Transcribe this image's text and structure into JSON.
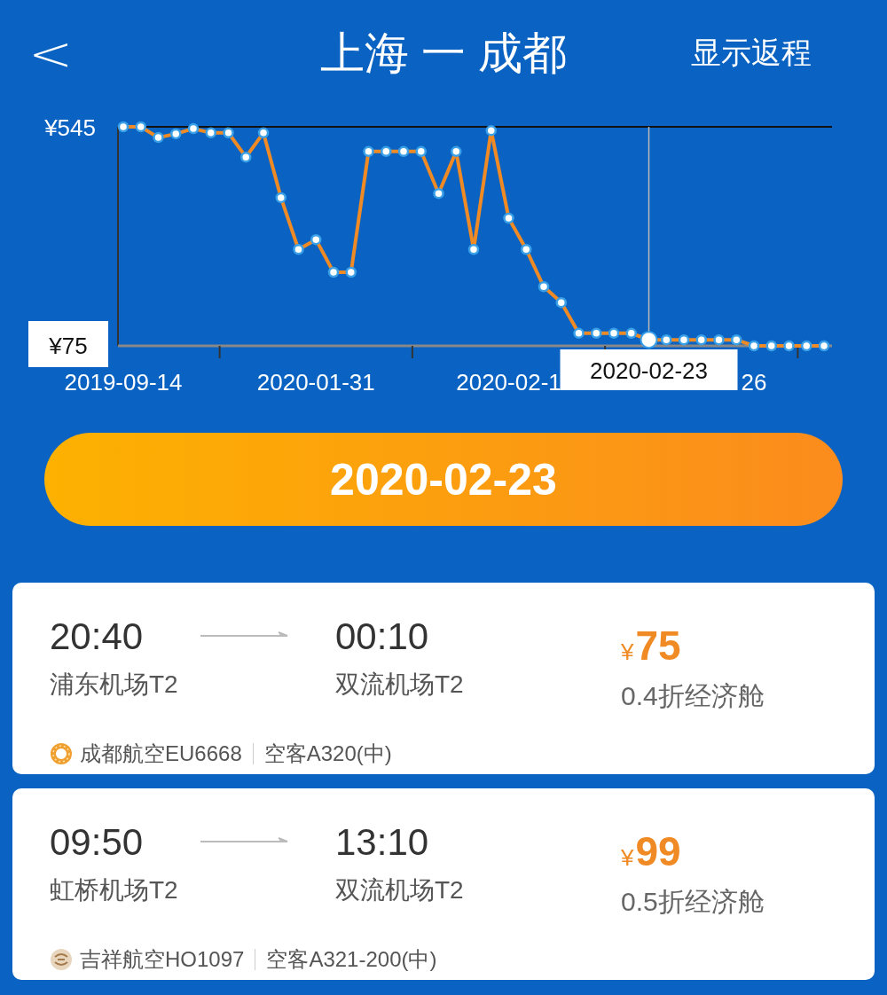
{
  "header": {
    "back": "<",
    "title": "上海 一 成都",
    "return_toggle": "显示返程"
  },
  "chart": {
    "chart_data": {
      "type": "line",
      "categories": [
        "2019-09-14",
        null,
        null,
        null,
        null,
        null,
        null,
        null,
        null,
        null,
        null,
        "2020-01-31",
        null,
        null,
        null,
        null,
        null,
        null,
        null,
        null,
        null,
        null,
        "2020-02-1",
        null,
        null,
        null,
        null,
        null,
        null,
        null,
        null,
        null,
        null,
        null,
        null,
        null,
        "26",
        null,
        null,
        null,
        null
      ],
      "series": [
        {
          "color": "#f08a24",
          "marker": "circle",
          "values": [
            545,
            545,
            522,
            530,
            541,
            532,
            532,
            480,
            532,
            393,
            282,
            303,
            233,
            233,
            492,
            492,
            492,
            492,
            402,
            492,
            282,
            537,
            349,
            282,
            202,
            168,
            102,
            102,
            102,
            102,
            88,
            88,
            88,
            88,
            88,
            88,
            75,
            75,
            75,
            75,
            75
          ]
        }
      ],
      "ylim": [
        75,
        545
      ],
      "yticks": [
        {
          "value": 545,
          "label": "¥545"
        },
        {
          "value": 75,
          "label": "¥75"
        }
      ],
      "annotations": [
        "2020-02-23"
      ]
    }
  },
  "date_button": {
    "label": "2020-02-23"
  },
  "flights": [
    {
      "depart_time": "20:40",
      "arrive_time": "00:10",
      "depart_airport": "浦东机场T2",
      "arrive_airport": "双流机场T2",
      "kind": "ring",
      "airline": "成都航空EU6668",
      "aircraft": "空客A320(中)",
      "currency": "¥",
      "price": "75",
      "cabin": "0.4折经济舱"
    },
    {
      "depart_time": "09:50",
      "arrive_time": "13:10",
      "depart_airport": "虹桥机场T2",
      "arrive_airport": "双流机场T2",
      "kind": "emblem",
      "airline": "吉祥航空HO1097",
      "aircraft": "空客A321-200(中)",
      "currency": "¥",
      "price": "99",
      "cabin": "0.5折经济舱"
    }
  ]
}
